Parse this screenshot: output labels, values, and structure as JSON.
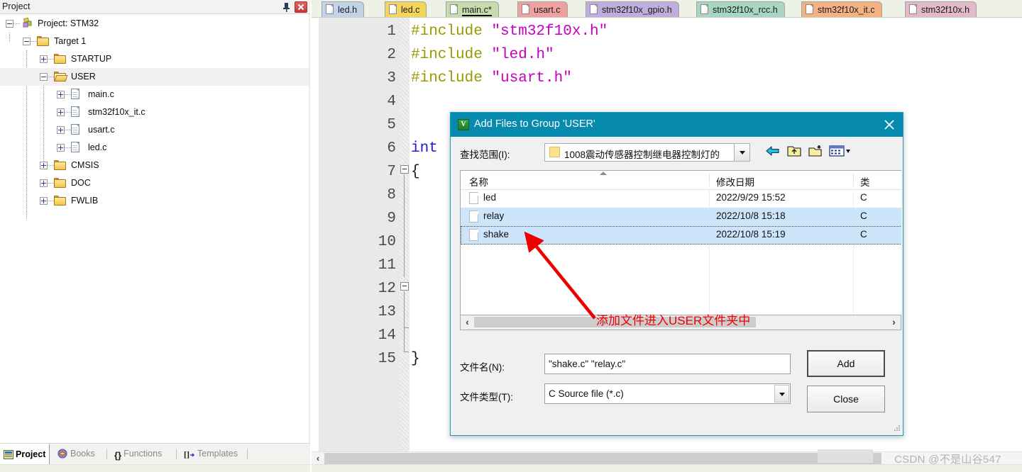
{
  "project_panel": {
    "title": "Project",
    "pin_icon": "pin-icon",
    "close_icon": "close-icon",
    "tree": [
      {
        "label": "Project: STM32",
        "icon": "project-icon",
        "expander": "minus",
        "depth": 0
      },
      {
        "label": "Target 1",
        "icon": "target-folder-icon",
        "expander": "minus",
        "depth": 1
      },
      {
        "label": "STARTUP",
        "icon": "folder-closed-icon",
        "expander": "plus",
        "depth": 2
      },
      {
        "label": "USER",
        "icon": "folder-open-icon",
        "expander": "minus",
        "depth": 2,
        "selected": true
      },
      {
        "label": "main.c",
        "icon": "c-file-icon",
        "expander": "plus",
        "depth": 3
      },
      {
        "label": "stm32f10x_it.c",
        "icon": "c-file-icon",
        "expander": "plus",
        "depth": 3
      },
      {
        "label": "usart.c",
        "icon": "c-file-icon",
        "expander": "plus",
        "depth": 3
      },
      {
        "label": "led.c",
        "icon": "c-file-icon",
        "expander": "plus",
        "depth": 3
      },
      {
        "label": "CMSIS",
        "icon": "folder-closed-icon",
        "expander": "plus",
        "depth": 2
      },
      {
        "label": "DOC",
        "icon": "folder-closed-icon",
        "expander": "plus",
        "depth": 2
      },
      {
        "label": "FWLIB",
        "icon": "folder-closed-icon",
        "expander": "plus",
        "depth": 2
      }
    ],
    "bottom_tabs": [
      {
        "label": "Project",
        "icon": "project-window-icon",
        "active": true
      },
      {
        "label": "Books",
        "icon": "books-icon",
        "active": false
      },
      {
        "label": "Functions",
        "icon": "braces-icon",
        "active": false
      },
      {
        "label": "Templates",
        "icon": "templates-icon",
        "active": false
      }
    ]
  },
  "editor": {
    "tabs": [
      {
        "label": "led.h",
        "color": "#c3d3ea",
        "active": false
      },
      {
        "label": "led.c",
        "color": "#f6d55c",
        "active": false
      },
      {
        "label": "main.c*",
        "color": "#c7dcae",
        "active": true
      },
      {
        "label": "usart.c",
        "color": "#efa0a0",
        "active": false
      },
      {
        "label": "stm32f10x_gpio.h",
        "color": "#bfaedd",
        "active": false
      },
      {
        "label": "stm32f10x_rcc.h",
        "color": "#a8d5c4",
        "active": false
      },
      {
        "label": "stm32f10x_it.c",
        "color": "#f4b183",
        "active": false
      },
      {
        "label": "stm32f10x.h",
        "color": "#e3b8c9",
        "active": false
      }
    ],
    "lines": [
      {
        "num": "1",
        "tokens": [
          {
            "t": "#include ",
            "c": "pre"
          },
          {
            "t": "\"stm32f10x.h\"",
            "c": "str"
          }
        ]
      },
      {
        "num": "2",
        "tokens": [
          {
            "t": "#include ",
            "c": "pre"
          },
          {
            "t": "\"led.h\"",
            "c": "str"
          }
        ]
      },
      {
        "num": "3",
        "tokens": [
          {
            "t": "#include ",
            "c": "pre"
          },
          {
            "t": "\"usart.h\"",
            "c": "str"
          }
        ]
      },
      {
        "num": "4",
        "tokens": []
      },
      {
        "num": "5",
        "tokens": []
      },
      {
        "num": "6",
        "tokens": [
          {
            "t": "int",
            "c": "kw"
          }
        ]
      },
      {
        "num": "7",
        "tokens": [
          {
            "t": "{",
            "c": "plain"
          }
        ]
      },
      {
        "num": "8",
        "tokens": []
      },
      {
        "num": "9",
        "tokens": []
      },
      {
        "num": "10",
        "tokens": []
      },
      {
        "num": "11",
        "tokens": []
      },
      {
        "num": "12",
        "tokens": []
      },
      {
        "num": "13",
        "tokens": []
      },
      {
        "num": "14",
        "tokens": []
      },
      {
        "num": "15",
        "tokens": [
          {
            "t": "}",
            "c": "plain"
          }
        ]
      }
    ],
    "scroll_left_arrow": "‹"
  },
  "dialog": {
    "title": "Add Files to Group 'USER'",
    "title_icon": "keil-app-icon",
    "close_icon": "close-icon",
    "lookin_label": "查找范围(I):",
    "lookin_value": "1008震动传感器控制继电器控制灯的",
    "toolbar": [
      {
        "name": "back-icon"
      },
      {
        "name": "up-folder-icon"
      },
      {
        "name": "new-folder-icon"
      },
      {
        "name": "view-mode-icon"
      }
    ],
    "columns": [
      "名称",
      "修改日期",
      "类"
    ],
    "files": [
      {
        "name": "led",
        "date": "2022/9/29 15:52",
        "type": "C ",
        "selected": false,
        "focused": false
      },
      {
        "name": "relay",
        "date": "2022/10/8 15:18",
        "type": "C ",
        "selected": true,
        "focused": false
      },
      {
        "name": "shake",
        "date": "2022/10/8 15:19",
        "type": "C ",
        "selected": true,
        "focused": true
      }
    ],
    "filename_label": "文件名(N):",
    "filename_value": "\"shake.c\" \"relay.c\"",
    "filetype_label": "文件类型(T):",
    "filetype_value": "C Source file (*.c)",
    "add_button": "Add",
    "close_button": "Close",
    "hscroll_left": "‹",
    "hscroll_right": "›"
  },
  "annotation": {
    "text": "添加文件进入USER文件夹中",
    "color": "#ee0000",
    "arrow": "red-arrow"
  },
  "watermark": "CSDN @不是山谷547"
}
